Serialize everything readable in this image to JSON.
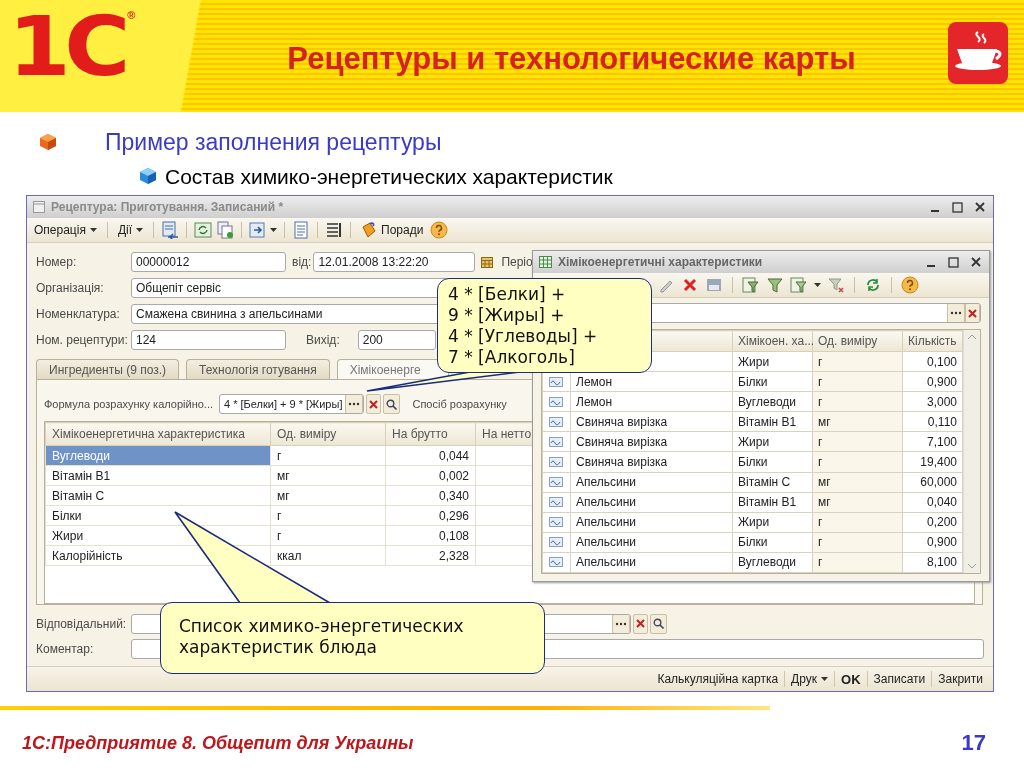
{
  "slide": {
    "logo": "1С",
    "logo_mark": "®",
    "title": "Рецептуры и технологические карты",
    "bullets": [
      {
        "text": "Пример заполнения рецептуры",
        "children": [
          {
            "text": "Состав химико-энергетических характеристик"
          }
        ]
      }
    ]
  },
  "recipe_window": {
    "title": "Рецептура: Приготування. Записаний *",
    "toolbar_menus": [
      "Операція",
      "Дії"
    ],
    "hint_button": "Поради",
    "fields": {
      "number": {
        "label": "Номер:",
        "value": "00000012"
      },
      "date": {
        "label": "від:",
        "value": "12.01.2008 13:22:20"
      },
      "period": {
        "label": "Періо"
      },
      "organization": {
        "label": "Організація:",
        "value": "Общепіт сервіс"
      },
      "item": {
        "label": "Номенклатура:",
        "value": "Смажена свинина з апельсинами"
      },
      "recipe_no": {
        "label": "Ном. рецептури:",
        "value": "124"
      },
      "output": {
        "label": "Вихід:",
        "value": "200"
      }
    },
    "tabs": [
      {
        "label": "Ингредиенты (9 поз.)",
        "selected": false
      },
      {
        "label": "Технологія готування",
        "selected": false
      },
      {
        "label": "Хімікоенерге",
        "selected": true
      }
    ],
    "formula": {
      "label": "Формула розрахунку калорійно...",
      "value": "4 * [Белки] + 9 * [Жиры]",
      "method_label": "Спосіб розрахунку"
    },
    "table": {
      "columns": [
        "Хімікоенергетична характеристика",
        "Од. виміру",
        "На брутто",
        "На нетто"
      ],
      "rows": [
        {
          "cells": [
            "Вуглеводи",
            "г",
            "0,044"
          ],
          "selected": true
        },
        {
          "cells": [
            "Вітамін В1",
            "мг",
            "0,002"
          ],
          "selected": false
        },
        {
          "cells": [
            "Вітамін С",
            "мг",
            "0,340"
          ],
          "selected": false
        },
        {
          "cells": [
            "Білки",
            "г",
            "0,296"
          ],
          "selected": false
        },
        {
          "cells": [
            "Жири",
            "г",
            "0,108"
          ],
          "selected": false
        },
        {
          "cells": [
            "Калорійність",
            "ккал",
            "2,328"
          ],
          "selected": false
        }
      ]
    },
    "responsible": {
      "label": "Відповідальний:"
    },
    "comment": {
      "label": "Коментар:"
    },
    "footer_buttons": [
      {
        "label": "Калькуляційна картка",
        "kind": "button",
        "default": false
      },
      {
        "label": "Друк",
        "kind": "menu",
        "default": false
      },
      {
        "label": "OK",
        "kind": "button",
        "default": true
      },
      {
        "label": "Записати",
        "kind": "button",
        "default": false
      },
      {
        "label": "Закрити",
        "kind": "button",
        "default": false
      }
    ]
  },
  "chars_window": {
    "title": "Хімікоенергетичні характеристики",
    "columns": [
      "Хімікоен. ха...",
      "Од. виміру",
      "Кількість"
    ],
    "rows": [
      {
        "characteristic": "Жири",
        "unit": "г",
        "amount": "0,100"
      },
      {
        "name": "Лемон",
        "characteristic": "Білки",
        "unit": "г",
        "amount": "0,900"
      },
      {
        "name": "Лемон",
        "characteristic": "Вуглеводи",
        "unit": "г",
        "amount": "3,000"
      },
      {
        "name": "Свиняча вирізка",
        "characteristic": "Вітамін В1",
        "unit": "мг",
        "amount": "0,110"
      },
      {
        "name": "Свиняча вирізка",
        "characteristic": "Жири",
        "unit": "г",
        "amount": "7,100"
      },
      {
        "name": "Свиняча вирізка",
        "characteristic": "Білки",
        "unit": "г",
        "amount": "19,400"
      },
      {
        "name": "Апельсини",
        "characteristic": "Вітамін С",
        "unit": "мг",
        "amount": "60,000"
      },
      {
        "name": "Апельсини",
        "characteristic": "Вітамін В1",
        "unit": "мг",
        "amount": "0,040"
      },
      {
        "name": "Апельсини",
        "characteristic": "Жири",
        "unit": "г",
        "amount": "0,200"
      },
      {
        "name": "Апельсини",
        "characteristic": "Білки",
        "unit": "г",
        "amount": "0,900"
      },
      {
        "name": "Апельсини",
        "characteristic": "Вуглеводи",
        "unit": "г",
        "amount": "8,100"
      }
    ]
  },
  "callouts": [
    {
      "kind": "formula",
      "lines": [
        "4 * [Белки] +",
        "9 * [Жиры] +",
        "4 * [Углеводы] +",
        "7 * [Алкоголь]"
      ]
    },
    {
      "kind": "list",
      "lines": [
        "Список химико-энергетических",
        "характеристик блюда"
      ]
    }
  ],
  "footer": {
    "text": "1С:Предприятие 8. Общепит для Украины",
    "page": "17"
  }
}
